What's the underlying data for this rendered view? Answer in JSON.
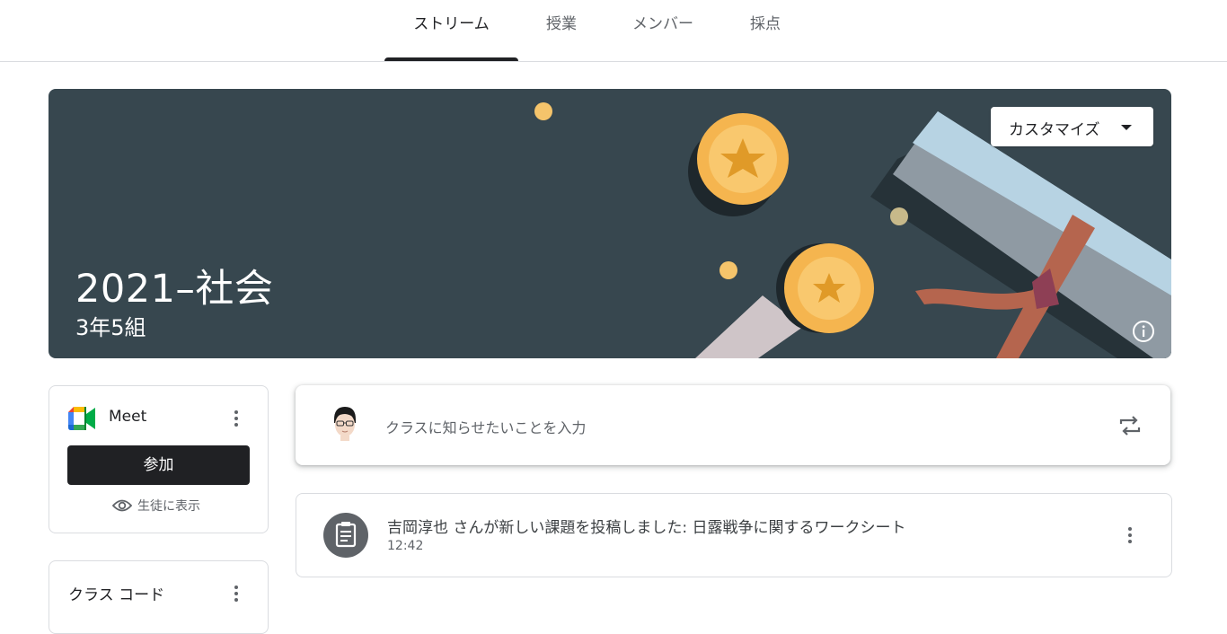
{
  "tabs": [
    {
      "label": "ストリーム",
      "active": true
    },
    {
      "label": "授業",
      "active": false
    },
    {
      "label": "メンバー",
      "active": false
    },
    {
      "label": "採点",
      "active": false
    }
  ],
  "banner": {
    "title": "2021–社会",
    "section": "3年5組",
    "customize_label": "カスタマイズ",
    "background_color": "#37474f"
  },
  "meet": {
    "title": "Meet",
    "join_label": "参加",
    "visible_label": "生徒に表示"
  },
  "class_code": {
    "title": "クラス コード"
  },
  "announce": {
    "placeholder": "クラスに知らせたいことを入力"
  },
  "stream": [
    {
      "text": "吉岡淳也 さんが新しい課題を投稿しました: 日露戦争に関するワークシート",
      "time": "12:42",
      "icon": "assignment-icon"
    }
  ]
}
